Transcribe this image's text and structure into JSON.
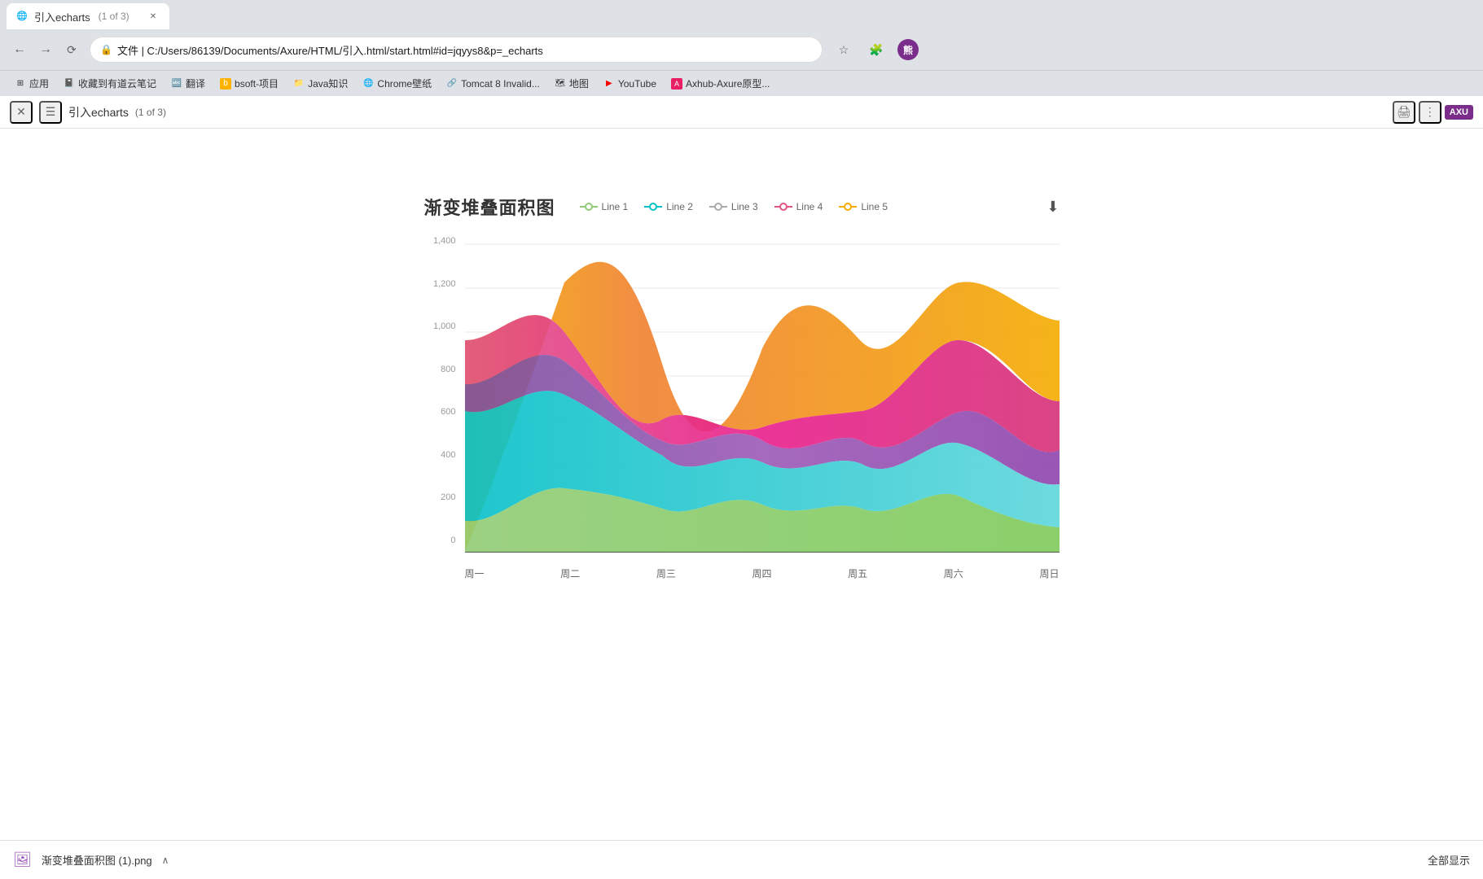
{
  "browser": {
    "address": "文件 | C:/Users/86139/Documents/Axure/HTML/引入.html/start.html#id=jqyys8&p=_echarts",
    "tab_title": "引入echarts",
    "tab_page": "(1 of 3)",
    "axu_logo": "AXU"
  },
  "bookmarks": [
    {
      "label": "应用",
      "icon": "⊞"
    },
    {
      "label": "收藏到有道云笔记",
      "icon": "📓"
    },
    {
      "label": "翻译",
      "icon": "🔤"
    },
    {
      "label": "bsoft-项目",
      "icon": "📁"
    },
    {
      "label": "Java知识",
      "icon": "📁"
    },
    {
      "label": "Chrome壁纸",
      "icon": "🌐"
    },
    {
      "label": "Tomcat 8 Invalid...",
      "icon": "🔗"
    },
    {
      "label": "地图",
      "icon": "🗺"
    },
    {
      "label": "YouTube",
      "icon": "▶"
    },
    {
      "label": "Axhub-Axure原型...",
      "icon": "A"
    }
  ],
  "toolbar": {
    "close_label": "✕",
    "menu_label": "☰",
    "title": "引入echarts",
    "page_info": "(1 of 3)",
    "print_icon": "🖨",
    "more_icon": "⋮"
  },
  "chart": {
    "title": "渐变堆叠面积图",
    "legend": [
      {
        "label": "Line 1",
        "color": "#91cc75"
      },
      {
        "label": "Line 2",
        "color": "#06c0c8"
      },
      {
        "label": "Line 3",
        "color": "#aaaaaa"
      },
      {
        "label": "Line 4",
        "color": "#e05585"
      },
      {
        "label": "Line 5",
        "color": "#f4a c00"
      }
    ],
    "y_axis": [
      "1,400",
      "1,200",
      "1,000",
      "800",
      "600",
      "400",
      "200",
      "0"
    ],
    "x_axis": [
      "周一",
      "周二",
      "周三",
      "周四",
      "周五",
      "周六",
      "周日"
    ],
    "download_icon": "⬇"
  },
  "download_bar": {
    "file_name": "渐变堆叠面积图 (1).png",
    "chevron": "∧",
    "show_all": "全部显示"
  }
}
